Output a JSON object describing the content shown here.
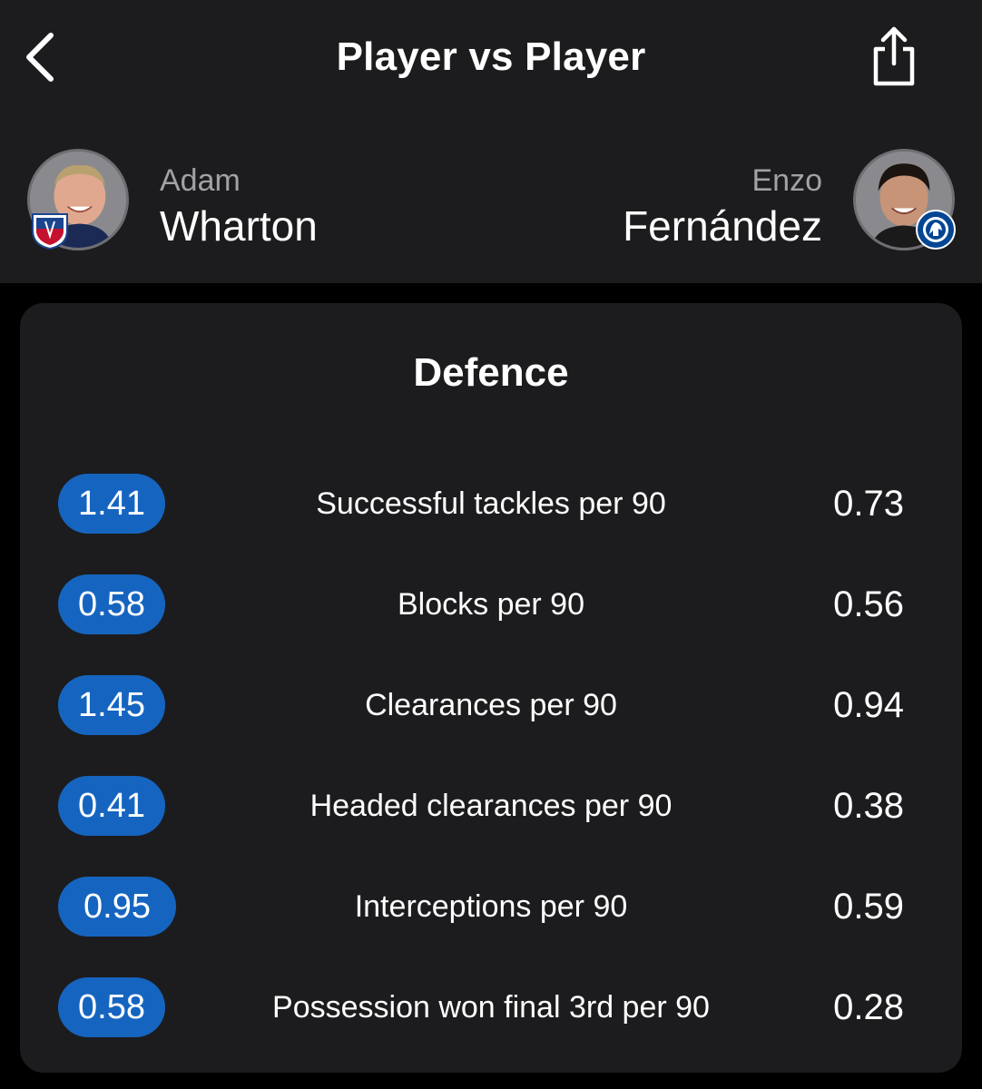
{
  "nav": {
    "title": "Player vs Player",
    "back_icon": "chevron-left-icon",
    "share_icon": "share-icon"
  },
  "players": {
    "left": {
      "first_name": "Adam",
      "last_name": "Wharton",
      "club_badge": "crystal-palace-badge"
    },
    "right": {
      "first_name": "Enzo",
      "last_name": "Fernández",
      "club_badge": "chelsea-badge"
    }
  },
  "section": {
    "title": "Defence"
  },
  "stats": [
    {
      "label": "Successful tackles per 90",
      "left": "1.41",
      "right": "0.73"
    },
    {
      "label": "Blocks per 90",
      "left": "0.58",
      "right": "0.56"
    },
    {
      "label": "Clearances per 90",
      "left": "1.45",
      "right": "0.94"
    },
    {
      "label": "Headed clearances per 90",
      "left": "0.41",
      "right": "0.38"
    },
    {
      "label": "Interceptions per 90",
      "left": "0.95",
      "right": "0.59"
    },
    {
      "label": "Possession won final 3rd per 90",
      "left": "0.58",
      "right": "0.28"
    }
  ],
  "colors": {
    "background": "#000000",
    "surface": "#1c1c1e",
    "highlight_pill": "#1565c0",
    "secondary_text": "#a1a1a6"
  }
}
